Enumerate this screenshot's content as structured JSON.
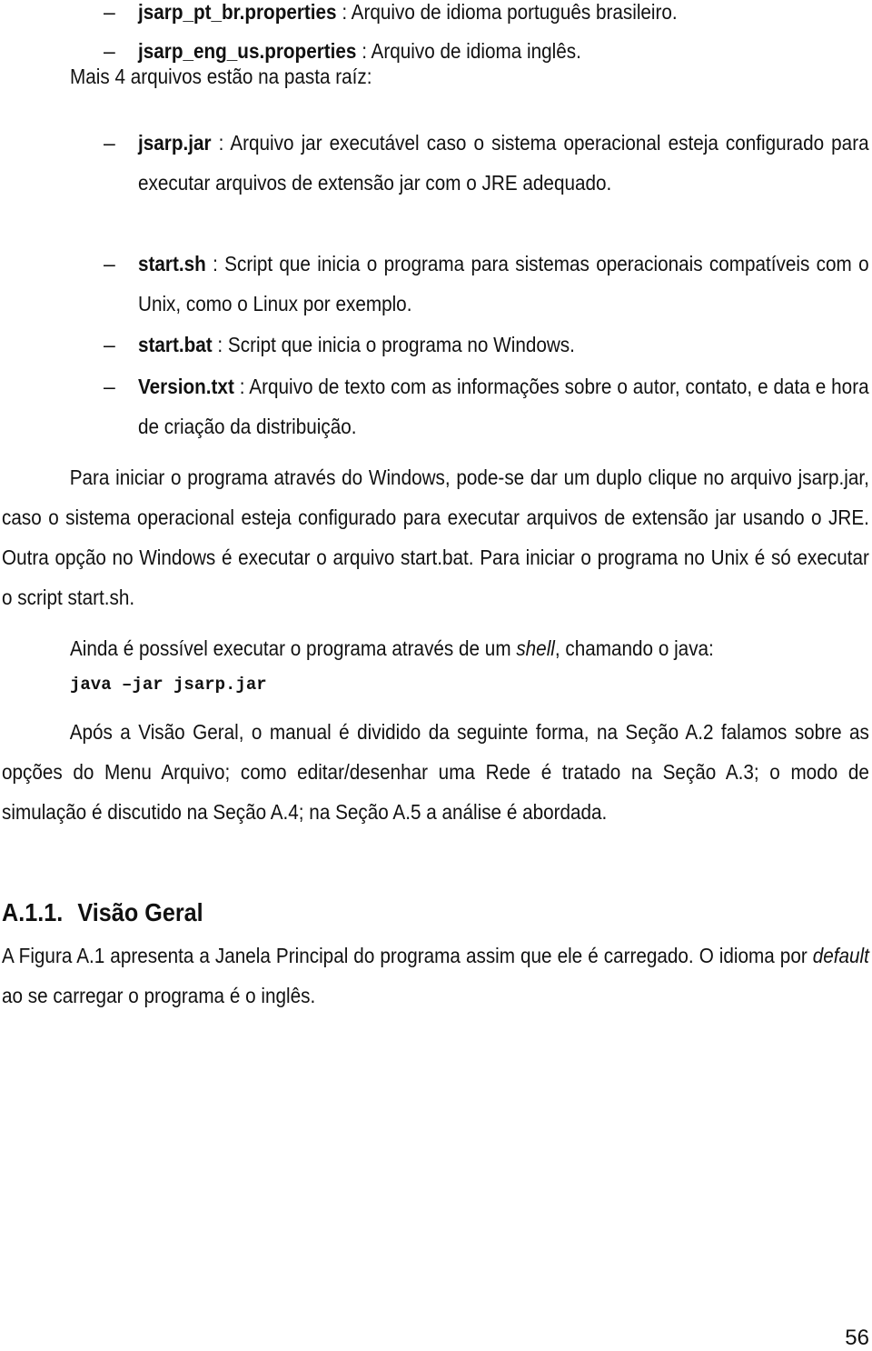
{
  "bullets_top": [
    {
      "name": "jsarp_pt_br.properties",
      "desc": " : Arquivo de idioma português brasileiro."
    },
    {
      "name": "jsarp_eng_us.properties",
      "desc": " : Arquivo de idioma inglês."
    }
  ],
  "intro_root": "Mais 4 arquivos estão na pasta raíz:",
  "bullets_root": [
    {
      "name": "jsarp.jar",
      "desc": " : Arquivo jar executável caso o sistema operacional esteja configurado para executar arquivos de extensão jar com o JRE adequado."
    },
    {
      "name": "start.sh",
      "desc": " : Script que inicia o programa para sistemas operacionais compatíveis com o Unix, como o Linux por exemplo."
    },
    {
      "name": "start.bat",
      "desc": " : Script que inicia o programa no Windows."
    },
    {
      "name": "Version.txt",
      "desc": " : Arquivo de texto com as informações sobre o autor, contato, e data e hora de criação da distribuição."
    }
  ],
  "para_start": "Para iniciar o programa através do Windows, pode-se dar um duplo clique no arquivo jsarp.jar, caso o sistema operacional esteja configurado para executar arquivos de extensão jar usando o JRE. Outra opção no Windows é executar o arquivo start.bat. Para iniciar o programa no Unix é só executar o script start.sh.",
  "para_shell": {
    "before": "Ainda é possível executar o programa através de um ",
    "italic": "shell",
    "after": ", chamando o java:"
  },
  "code_command": "java –jar jsarp.jar",
  "para_sections": "Após a Visão Geral, o manual é dividido da seguinte forma, na Seção A.2 falamos sobre as opções do Menu Arquivo; como editar/desenhar uma Rede é tratado na Seção A.3; o modo de simulação é discutido na Seção A.4; na Seção A.5 a análise é abordada.",
  "heading": {
    "number": "A.1.1.",
    "title": "Visão Geral"
  },
  "para_overview": {
    "before": "A Figura A.1 apresenta a Janela Principal do programa assim que ele é carregado. O idioma por ",
    "italic": "default",
    "after": " ao se carregar o programa é o inglês."
  },
  "bullet_glyph": "–",
  "page_number": "56"
}
